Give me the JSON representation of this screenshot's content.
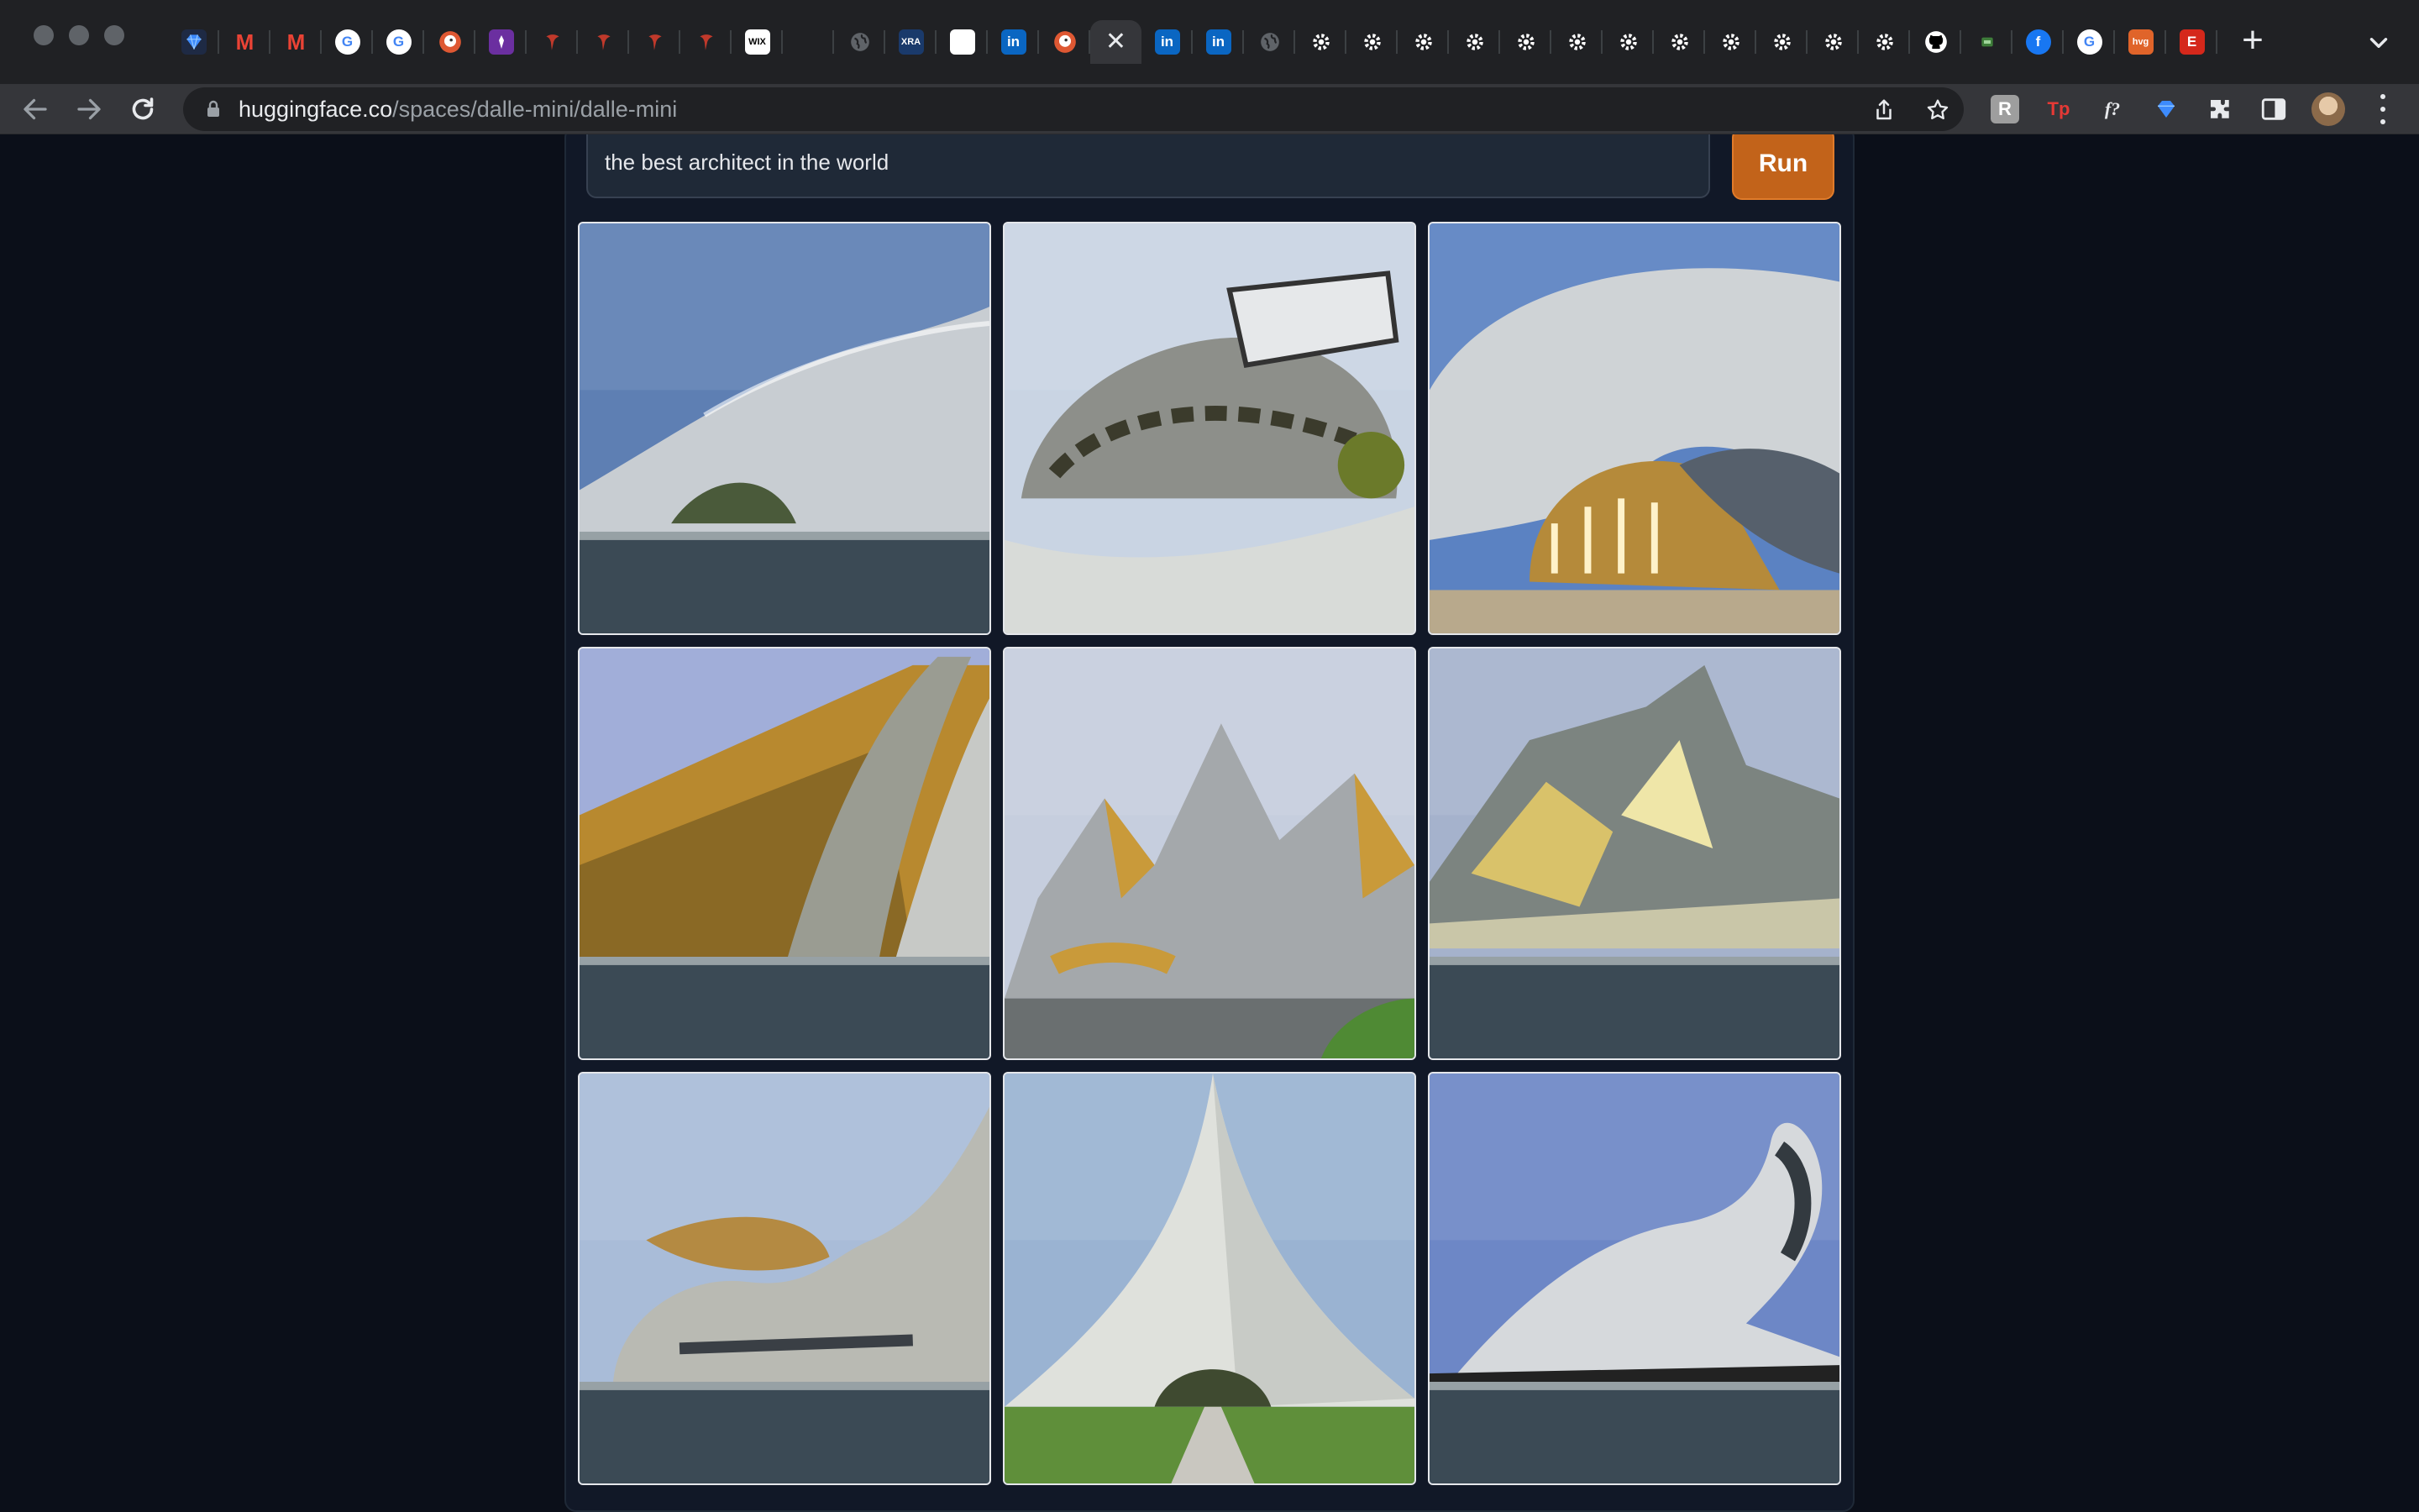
{
  "browser": {
    "address_host": "huggingface.co",
    "address_path": "/spaces/dalle-mini/dalle-mini",
    "tabs": [
      {
        "icon": "gem-icon",
        "glyph": "",
        "bg": "#1e2a44",
        "color": "#4aa3ff"
      },
      {
        "icon": "gmail-icon",
        "glyph": "M",
        "bg": "transparent",
        "color": "#ea4335"
      },
      {
        "icon": "gmail-icon",
        "glyph": "M",
        "bg": "transparent",
        "color": "#ea4335"
      },
      {
        "icon": "google-icon",
        "glyph": "G",
        "bg": "#ffffff",
        "color": "#4285f4"
      },
      {
        "icon": "google-icon",
        "glyph": "G",
        "bg": "#ffffff",
        "color": "#4285f4"
      },
      {
        "icon": "duckduckgo-icon",
        "glyph": "",
        "bg": "#de5833",
        "color": "#ffffff"
      },
      {
        "icon": "purple-app-icon",
        "glyph": "",
        "bg": "#6b2fa0",
        "color": "#ffffff"
      },
      {
        "icon": "red-pin-icon",
        "glyph": "",
        "bg": "transparent",
        "color": "#c0392b"
      },
      {
        "icon": "red-pin-icon",
        "glyph": "",
        "bg": "transparent",
        "color": "#c0392b"
      },
      {
        "icon": "red-pin-icon",
        "glyph": "",
        "bg": "transparent",
        "color": "#c0392b"
      },
      {
        "icon": "red-pin-icon",
        "glyph": "",
        "bg": "transparent",
        "color": "#c0392b"
      },
      {
        "icon": "wix-icon",
        "glyph": "WIX",
        "bg": "#ffffff",
        "color": "#000000"
      },
      {
        "icon": "blank-icon",
        "glyph": "",
        "bg": "transparent",
        "color": "#ffffff"
      },
      {
        "icon": "globe-icon",
        "glyph": "",
        "bg": "transparent",
        "color": "#9aa0a6"
      },
      {
        "icon": "xra-icon",
        "glyph": "XRA",
        "bg": "#1a3a6b",
        "color": "#ffffff"
      },
      {
        "icon": "white-square-icon",
        "glyph": "",
        "bg": "#ffffff",
        "color": "#ffffff"
      },
      {
        "icon": "linkedin-icon",
        "glyph": "in",
        "bg": "#0a66c2",
        "color": "#ffffff"
      },
      {
        "icon": "duckduckgo-icon",
        "glyph": "",
        "bg": "#de5833",
        "color": "#ffffff"
      },
      {
        "icon": "close-icon",
        "glyph": "",
        "bg": "transparent",
        "color": "#e8eaed",
        "active": true
      },
      {
        "icon": "linkedin-icon",
        "glyph": "in",
        "bg": "#0a66c2",
        "color": "#ffffff"
      },
      {
        "icon": "linkedin-icon",
        "glyph": "in",
        "bg": "#0a66c2",
        "color": "#ffffff"
      },
      {
        "icon": "globe-icon",
        "glyph": "",
        "bg": "transparent",
        "color": "#9aa0a6"
      },
      {
        "icon": "gear-icon",
        "glyph": "",
        "bg": "transparent",
        "color": "#ffffff"
      },
      {
        "icon": "gear-icon",
        "glyph": "",
        "bg": "transparent",
        "color": "#ffffff"
      },
      {
        "icon": "gear-icon",
        "glyph": "",
        "bg": "transparent",
        "color": "#ffffff"
      },
      {
        "icon": "gear-icon",
        "glyph": "",
        "bg": "transparent",
        "color": "#ffffff"
      },
      {
        "icon": "gear-icon",
        "glyph": "",
        "bg": "transparent",
        "color": "#ffffff"
      },
      {
        "icon": "gear-icon",
        "glyph": "",
        "bg": "transparent",
        "color": "#ffffff"
      },
      {
        "icon": "gear-icon",
        "glyph": "",
        "bg": "transparent",
        "color": "#ffffff"
      },
      {
        "icon": "gear-icon",
        "glyph": "",
        "bg": "transparent",
        "color": "#ffffff"
      },
      {
        "icon": "gear-icon",
        "glyph": "",
        "bg": "transparent",
        "color": "#ffffff"
      },
      {
        "icon": "gear-icon",
        "glyph": "",
        "bg": "transparent",
        "color": "#ffffff"
      },
      {
        "icon": "gear-icon",
        "glyph": "",
        "bg": "transparent",
        "color": "#ffffff"
      },
      {
        "icon": "gear-icon",
        "glyph": "",
        "bg": "transparent",
        "color": "#ffffff"
      },
      {
        "icon": "github-icon",
        "glyph": "",
        "bg": "#ffffff",
        "color": "#000000"
      },
      {
        "icon": "green-badge-icon",
        "glyph": "",
        "bg": "#3e7d3a",
        "color": "#ffffff"
      },
      {
        "icon": "facebook-icon",
        "glyph": "f",
        "bg": "#1877f2",
        "color": "#ffffff"
      },
      {
        "icon": "google-icon",
        "glyph": "G",
        "bg": "#ffffff",
        "color": "#4285f4"
      },
      {
        "icon": "hvg-icon",
        "glyph": "hvg",
        "bg": "#e0642a",
        "color": "#ffffff"
      },
      {
        "icon": "etsy-icon",
        "glyph": "E",
        "bg": "#d5281b",
        "color": "#ffffff"
      }
    ],
    "extensions": [
      {
        "icon": "extension-r-icon",
        "glyph": "R",
        "color": "#bdbdbd"
      },
      {
        "icon": "extension-tp-icon",
        "glyph": "Tp",
        "color": "#e53935"
      },
      {
        "icon": "extension-font-icon",
        "glyph": "f?",
        "color": "#e8eaed"
      },
      {
        "icon": "extension-gem-icon",
        "glyph": "",
        "color": "#4aa3ff"
      }
    ]
  },
  "app": {
    "prompt_value": "the best architect in the world",
    "run_label": "Run",
    "accent_color": "#c2631a",
    "images": [
      {
        "sky": "#5e7fb3",
        "body": "#c8cdd2",
        "accent": "#4a5a3a",
        "style": "wave"
      },
      {
        "sky": "#c9d4e3",
        "body": "#8d8f8a",
        "accent": "#6b7a2a",
        "style": "shell"
      },
      {
        "sky": "#5b82c2",
        "body": "#cfd3d6",
        "accent": "#b58a3a",
        "style": "dome"
      },
      {
        "sky": "#9aa8d6",
        "body": "#9a9c92",
        "accent": "#b8892f",
        "style": "fin"
      },
      {
        "sky": "#c6cede",
        "body": "#a4a8ab",
        "accent": "#c99a3a",
        "style": "peaks"
      },
      {
        "sky": "#a5b2cc",
        "body": "#7c8480",
        "accent": "#d9c26a",
        "style": "shard"
      },
      {
        "sky": "#a9bcd8",
        "body": "#b9bab3",
        "accent": "#b48a42",
        "style": "curl"
      },
      {
        "sky": "#9ab3d2",
        "body": "#dfe1dc",
        "accent": "#5f8f3a",
        "style": "tent"
      },
      {
        "sky": "#6d87c6",
        "body": "#d6d9dc",
        "accent": "#3f5c6a",
        "style": "loop"
      }
    ]
  }
}
